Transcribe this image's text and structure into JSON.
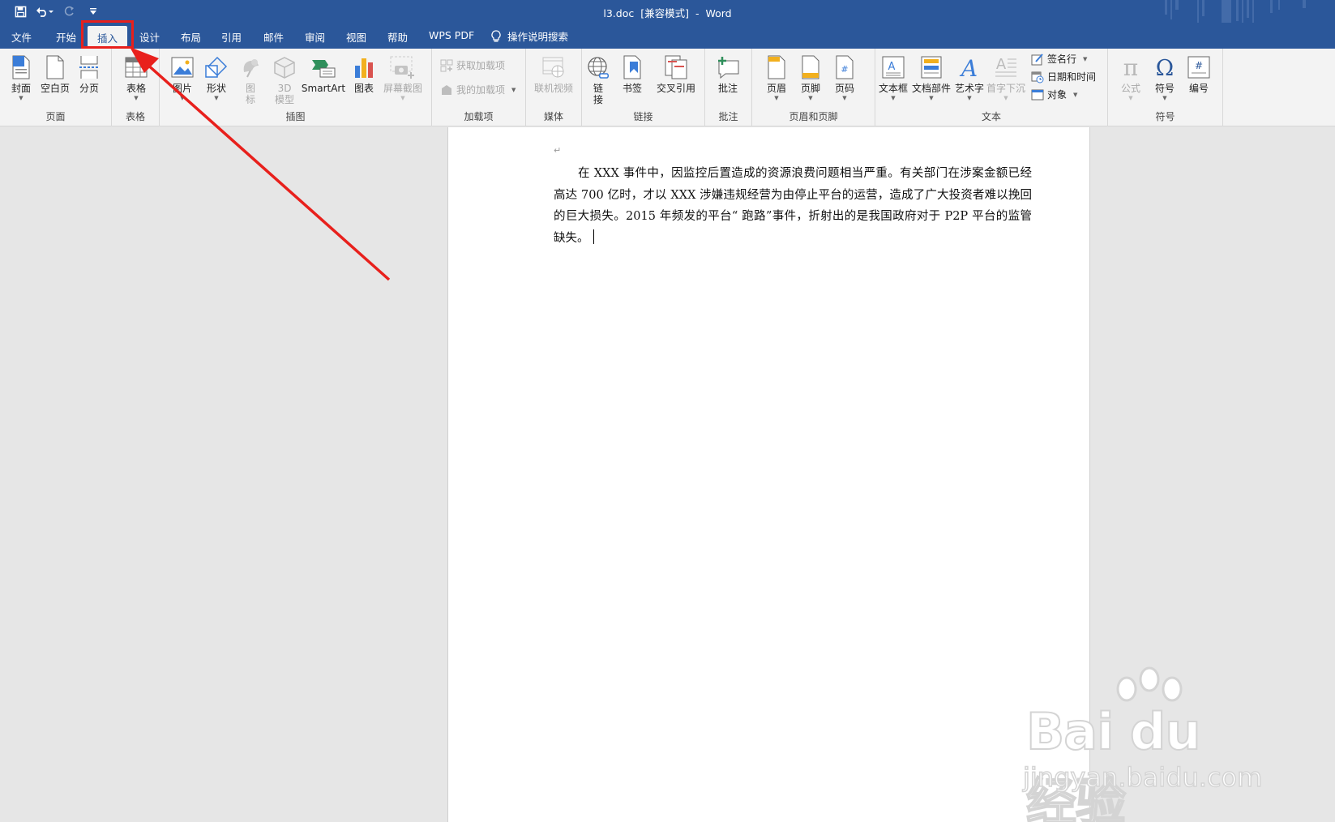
{
  "window": {
    "title_file": "l3.doc",
    "title_mode": "[兼容模式]",
    "title_sep": "-",
    "title_app": "Word"
  },
  "tabs": [
    {
      "label": "文件"
    },
    {
      "label": "开始"
    },
    {
      "label": "插入",
      "active": true
    },
    {
      "label": "设计"
    },
    {
      "label": "布局"
    },
    {
      "label": "引用"
    },
    {
      "label": "邮件"
    },
    {
      "label": "审阅"
    },
    {
      "label": "视图"
    },
    {
      "label": "帮助"
    },
    {
      "label": "WPS PDF"
    }
  ],
  "tell_me": "操作说明搜索",
  "ribbon": {
    "pages": {
      "label": "页面",
      "cover": "封面",
      "blank": "空白页",
      "break": "分页"
    },
    "tables": {
      "label": "表格",
      "table": "表格"
    },
    "illustrations": {
      "label": "插图",
      "picture": "图片",
      "shapes": "形状",
      "icons_1": "图",
      "icons_2": "标",
      "model3d_1": "3D",
      "model3d_2": "模型",
      "smartart": "SmartArt",
      "chart": "图表",
      "screenshot": "屏幕截图"
    },
    "addins": {
      "label": "加载项",
      "get": "获取加载项",
      "mine": "我的加载项"
    },
    "media": {
      "label": "媒体",
      "video": "联机视频"
    },
    "links": {
      "label": "链接",
      "link_1": "链",
      "link_2": "接",
      "bookmark": "书签",
      "crossref": "交叉引用"
    },
    "comments": {
      "label": "批注",
      "comment": "批注"
    },
    "headerfooter": {
      "label": "页眉和页脚",
      "header": "页眉",
      "footer": "页脚",
      "pagenum": "页码"
    },
    "text": {
      "label": "文本",
      "textbox": "文本框",
      "quickparts": "文档部件",
      "wordart": "艺术字",
      "dropcap": "首字下沉",
      "signature": "签名行",
      "datetime": "日期和时间",
      "object": "对象"
    },
    "symbols": {
      "label": "符号",
      "equation": "公式",
      "symbol": "符号",
      "number": "编号"
    }
  },
  "document": {
    "paragraph": "在 XXX 事件中，因监控后置造成的资源浪费问题相当严重。有关部门在涉案金额已经高达 700 亿时，才以 XXX 涉嫌违规经营为由停止平台的运营，造成了广大投资者难以挽回的巨大损失。2015 年频发的平台“ 跑路”事件，折射出的是我国政府对于 P2P 平台的监管缺失。"
  },
  "watermark": {
    "logo": "Bai du 经验",
    "url": "jingyan.baidu.com"
  },
  "colors": {
    "title_bar": "#2b579a",
    "ribbon": "#f3f3f3",
    "highlight": "#e8201c",
    "workspace": "#e6e6e6"
  }
}
